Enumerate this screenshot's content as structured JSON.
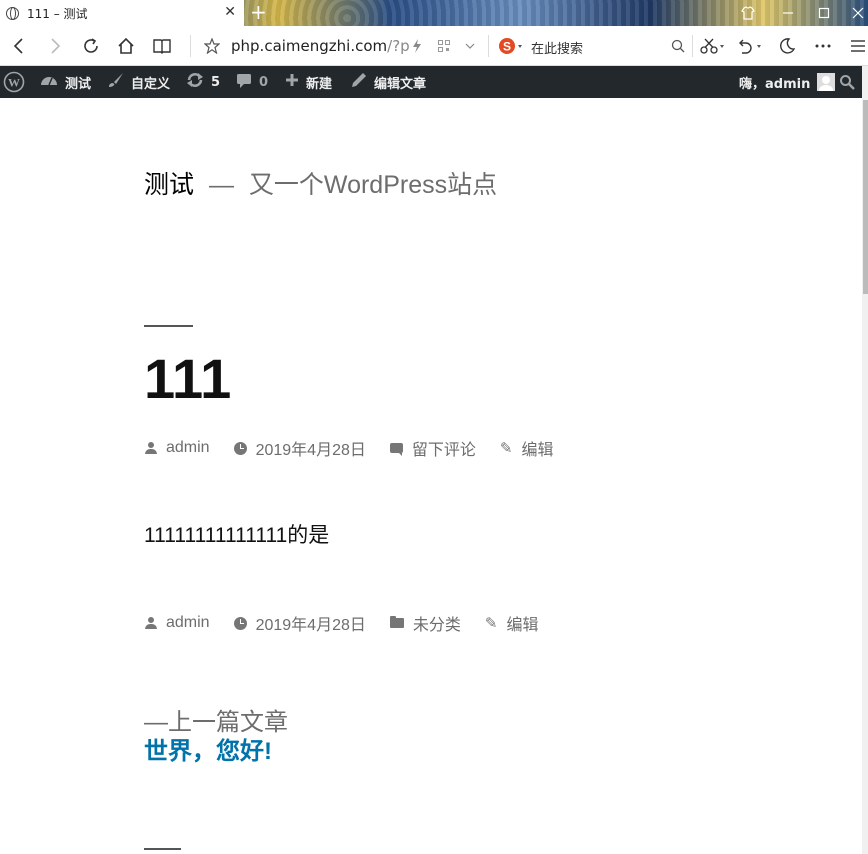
{
  "browser": {
    "tab_title": "111 – 测试",
    "url_main": "php.caimengzhi.com",
    "url_rest": "/?p",
    "search_placeholder": "在此搜索"
  },
  "adminbar": {
    "site": "测试",
    "customize": "自定义",
    "updates_count": "5",
    "comments_count": "0",
    "new": "新建",
    "edit_post": "编辑文章",
    "greeting": "嗨，admin"
  },
  "site": {
    "title": "测试",
    "separator": "—",
    "description": "又一个WordPress站点"
  },
  "post": {
    "title": "111",
    "author": "admin",
    "date": "2019年4月28日",
    "comment_link": "留下评论",
    "edit_link": "编辑",
    "body": "11111111111111的是",
    "category": "未分类"
  },
  "navigation": {
    "prev_label": "—上一篇文章",
    "prev_title": "世界，您好!"
  }
}
